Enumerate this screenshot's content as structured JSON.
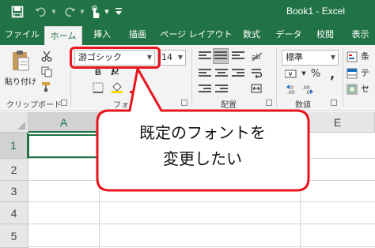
{
  "window": {
    "title": "Book1  -  Excel"
  },
  "colors": {
    "accent": "#217346",
    "callout_border": "#e8141e",
    "ribbon_bg": "#f3f3f3"
  },
  "quick_access": {
    "icons": [
      "save-icon",
      "undo-icon",
      "redo-icon",
      "touch-mode-icon",
      "customize-qat-icon"
    ]
  },
  "tabs": [
    {
      "label": "ファイル",
      "active": false
    },
    {
      "label": "ホーム",
      "active": true
    },
    {
      "label": "挿入",
      "active": false
    },
    {
      "label": "描画",
      "active": false
    },
    {
      "label": "ページ レイアウト",
      "active": false
    },
    {
      "label": "数式",
      "active": false
    },
    {
      "label": "データ",
      "active": false
    },
    {
      "label": "校閲",
      "active": false
    },
    {
      "label": "表示",
      "active": false
    }
  ],
  "ribbon": {
    "clipboard": {
      "paste_label": "貼り付け",
      "group_label": "クリップボード"
    },
    "font": {
      "font_name": "游ゴシック",
      "font_size": "14",
      "bold": "B",
      "italic": "I",
      "underline": "U",
      "group_label": "フォント"
    },
    "alignment": {
      "group_label": "配置"
    },
    "number": {
      "format": "標準",
      "currency": "¥",
      "percent": "%",
      "group_label": "数値"
    },
    "styles": {
      "label_1": "条",
      "label_2": "テ",
      "label_3": "セ"
    }
  },
  "sheet": {
    "columns": [
      "A",
      "E"
    ],
    "rows": [
      "1",
      "2",
      "3",
      "4",
      "5"
    ],
    "selected_cell": "A1"
  },
  "callout": {
    "line1": "既定のフォントを",
    "line2": "変更したい"
  }
}
